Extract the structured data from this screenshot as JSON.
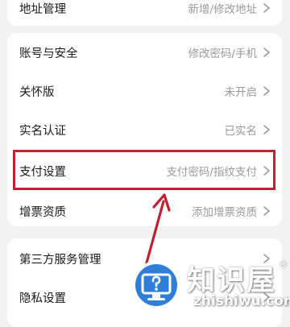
{
  "colors": {
    "background": "#f2f2f2",
    "card": "#ffffff",
    "label": "#1a1a1a",
    "value": "#9a9a9a",
    "highlight": "#c0202f",
    "logo_blue": "#2f7fd8"
  },
  "sections": {
    "top": {
      "rows": [
        {
          "label": "地址管理",
          "value": "新增/修改地址"
        }
      ]
    },
    "account": {
      "rows": [
        {
          "label": "账号与安全",
          "value": "修改密码/手机"
        },
        {
          "label": "关怀版",
          "value": "未开启"
        },
        {
          "label": "实名认证",
          "value": "已实名"
        },
        {
          "label": "支付设置",
          "value": "支付密码/指纹支付"
        },
        {
          "label": "增票资质",
          "value": "添加增票资质"
        }
      ]
    },
    "other": {
      "rows": [
        {
          "label": "第三方服务管理",
          "value": ""
        },
        {
          "label": "隐私设置",
          "value": ""
        }
      ]
    }
  },
  "icons": {
    "chevron": "chevron-right-icon",
    "watermark_logo": "monitor-question-icon"
  },
  "watermark": {
    "brand": "知识屋",
    "registered": "®",
    "url": "zhishiwu.com"
  }
}
